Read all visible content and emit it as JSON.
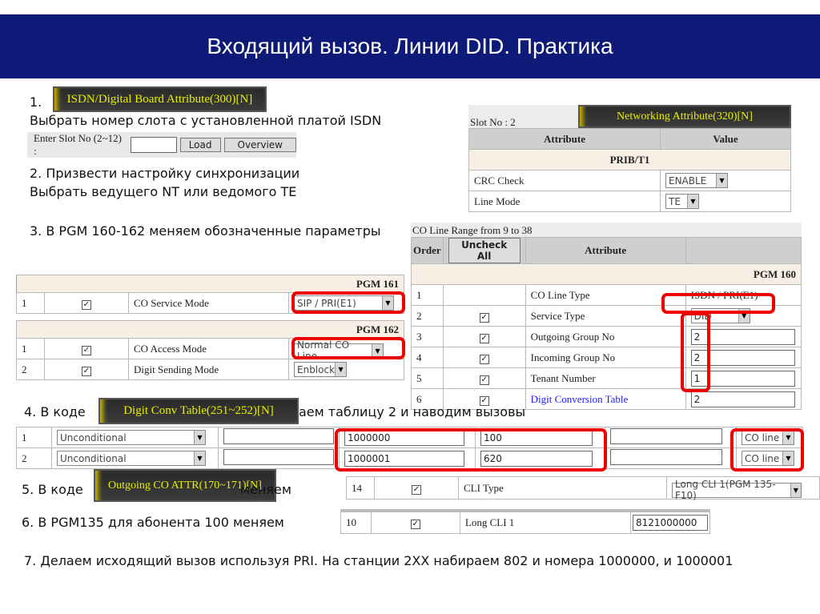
{
  "title": "Входящий вызов. Линии DID. Практика",
  "steps": {
    "s1_num": "1.",
    "s1_text": "Выбрать номер слота с установленной платой ISDN",
    "s2_a": "2. Призвести настройку синхронизации",
    "s2_b": "Выбрать ведущего NT или ведомого TE",
    "s3": "3. В PGM 160-162 меняем обозначенные параметры",
    "s4_a": "4. В коде",
    "s4_b": "аем таблицу 2  и наводим вызовы",
    "s5_a": "5. В коде",
    "s5_b": "меняем",
    "s6": "6. В PGM135 для абонента 100 меняем",
    "s7": "7. Делаем исходящий вызов используя PRI. На станции 2XX набираем 802 и номера 1000000, и 1000001"
  },
  "banners": {
    "isdn": "ISDN/Digital Board Attribute(300)[N]",
    "networking": "Networking Attribute(320)[N]",
    "digit_conv": "Digit Conv Table(251~252)[N]",
    "outgoing": "Outgoing CO ATTR(170~171)[N]"
  },
  "slot": {
    "label": "Enter Slot No (2~12) :",
    "value": "",
    "load": "Load",
    "overview": "Overview"
  },
  "net": {
    "slot_no": "Slot No : 2",
    "col_attr": "Attribute",
    "col_value": "Value",
    "section": "PRIB/T1",
    "rows": [
      {
        "attr": "CRC Check",
        "value": "ENABLE"
      },
      {
        "attr": "Line Mode",
        "value": "TE"
      }
    ]
  },
  "pgm161": {
    "title": "PGM 161",
    "rows": [
      {
        "n": "1",
        "check": "✓",
        "attr": "CO Service Mode",
        "value": "SIP / PRI(E1)"
      }
    ]
  },
  "pgm162": {
    "title": "PGM 162",
    "rows": [
      {
        "n": "1",
        "check": "✓",
        "attr": "CO Access Mode",
        "value": "Normal CO Line"
      },
      {
        "n": "2",
        "check": "✓",
        "attr": "Digit Sending Mode",
        "value": "Enblock"
      }
    ]
  },
  "pgm160": {
    "range": "CO Line Range from 9 to 38",
    "col_order": "Order",
    "uncheck": "Uncheck All",
    "col_attr": "Attribute",
    "title": "PGM 160",
    "rows": [
      {
        "n": "1",
        "attr": "CO Line Type",
        "value": "ISDN / PRI(E1)"
      },
      {
        "n": "2",
        "check": "✓",
        "attr": "Service Type",
        "value": "DID"
      },
      {
        "n": "3",
        "check": "✓",
        "attr": "Outgoing Group No",
        "value": "2"
      },
      {
        "n": "4",
        "check": "✓",
        "attr": "Incoming Group No",
        "value": "2"
      },
      {
        "n": "5",
        "check": "✓",
        "attr": "Tenant Number",
        "value": "1"
      },
      {
        "n": "6",
        "check": "✓",
        "attr": "Digit Conversion Table",
        "value": "2"
      }
    ]
  },
  "digit_conv": {
    "rows": [
      {
        "n": "1",
        "cond": "Unconditional",
        "a": "",
        "digits": "1000000",
        "conv": "100",
        "b": "",
        "dest": "CO line"
      },
      {
        "n": "2",
        "cond": "Unconditional",
        "a": "",
        "digits": "1000001",
        "conv": "620",
        "b": "",
        "dest": "CO line"
      }
    ]
  },
  "cli_type": {
    "n": "14",
    "check": "✓",
    "attr": "CLI Type",
    "value": "Long CLI 1(PGM 135-F10)"
  },
  "long_cli": {
    "n": "10",
    "check": "✓",
    "attr": "Long CLI 1",
    "value": "8121000000"
  }
}
